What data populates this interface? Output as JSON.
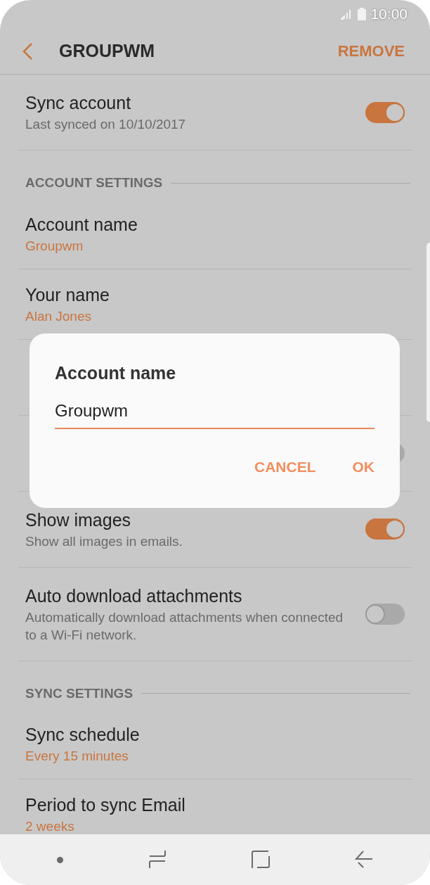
{
  "status_bar": {
    "time": "10:00"
  },
  "header": {
    "title": "GROUPWM",
    "action": "REMOVE"
  },
  "items": [
    {
      "kind": "toggle",
      "title": "Sync account",
      "subtitle": "Last synced on 10/10/2017",
      "on": true
    },
    {
      "kind": "section",
      "title": "ACCOUNT SETTINGS"
    },
    {
      "kind": "value",
      "title": "Account name",
      "subtitle": "Groupwm"
    },
    {
      "kind": "value",
      "title": "Your name",
      "subtitle": "Alan Jones"
    },
    {
      "kind": "covered"
    },
    {
      "kind": "covered_toggle",
      "on": false
    },
    {
      "kind": "toggle",
      "title": "Show images",
      "subtitle": "Show all images in emails.",
      "on": true
    },
    {
      "kind": "toggle",
      "title": "Auto download attachments",
      "subtitle": "Automatically download attachments when connected to a Wi-Fi network.",
      "on": false
    },
    {
      "kind": "section",
      "title": "SYNC SETTINGS"
    },
    {
      "kind": "value",
      "title": "Sync schedule",
      "subtitle": "Every 15 minutes"
    },
    {
      "kind": "value",
      "title": "Period to sync Email",
      "subtitle": "2 weeks"
    }
  ],
  "dialog": {
    "title": "Account name",
    "value": "Groupwm",
    "buttons": [
      "CANCEL",
      "OK"
    ]
  }
}
